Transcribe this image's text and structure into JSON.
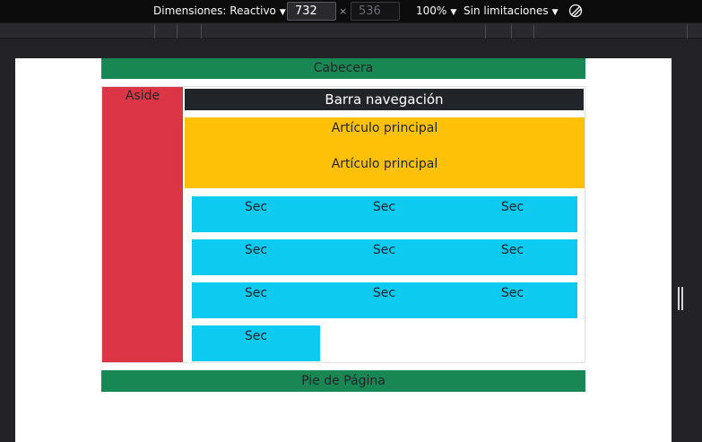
{
  "toolbar": {
    "dimensions_label": "Dimensiones: Reactivo",
    "width_value": "732",
    "times": "×",
    "height_value": "536",
    "zoom": "100%",
    "throttling": "Sin limitaciones",
    "rotate_icon": "rotate-icon"
  },
  "page": {
    "header": "Cabecera",
    "aside": "Aside",
    "navbar": "Barra navegación",
    "article_lines": [
      "Artículo principal",
      "Artículo principal"
    ],
    "sections": [
      [
        "Sec",
        "Sec",
        "Sec"
      ],
      [
        "Sec",
        "Sec",
        "Sec"
      ],
      [
        "Sec",
        "Sec",
        "Sec"
      ],
      [
        "Sec"
      ]
    ],
    "footer": "Pie de Página"
  },
  "colors": {
    "header": "#198754",
    "aside": "#dc3545",
    "navbar": "#212529",
    "article": "#ffc107",
    "section": "#0dcaf0",
    "footer": "#198754"
  }
}
